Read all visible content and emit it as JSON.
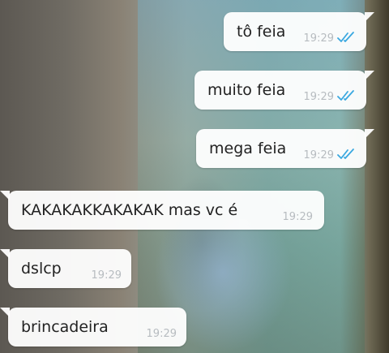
{
  "messages": [
    {
      "direction": "outgoing",
      "text": "tô feia",
      "time": "19:29",
      "status_icon": "double-check-icon",
      "status_color": "#3aa8e0"
    },
    {
      "direction": "outgoing",
      "text": "muito feia",
      "time": "19:29",
      "status_icon": "double-check-icon",
      "status_color": "#3aa8e0"
    },
    {
      "direction": "outgoing",
      "text": "mega feia",
      "time": "19:29",
      "status_icon": "double-check-icon",
      "status_color": "#3aa8e0"
    },
    {
      "direction": "incoming",
      "text": "KAKAKAKKAKAKAK mas vc é",
      "time": "19:29"
    },
    {
      "direction": "incoming",
      "text": "dslcp",
      "time": "19:29"
    },
    {
      "direction": "incoming",
      "text": "brincadeira",
      "time": "19:29"
    }
  ],
  "colors": {
    "bubble_bg": "#ffffff",
    "text": "#222222",
    "time": "#b7bcc0",
    "read_ticks": "#3aa8e0"
  }
}
